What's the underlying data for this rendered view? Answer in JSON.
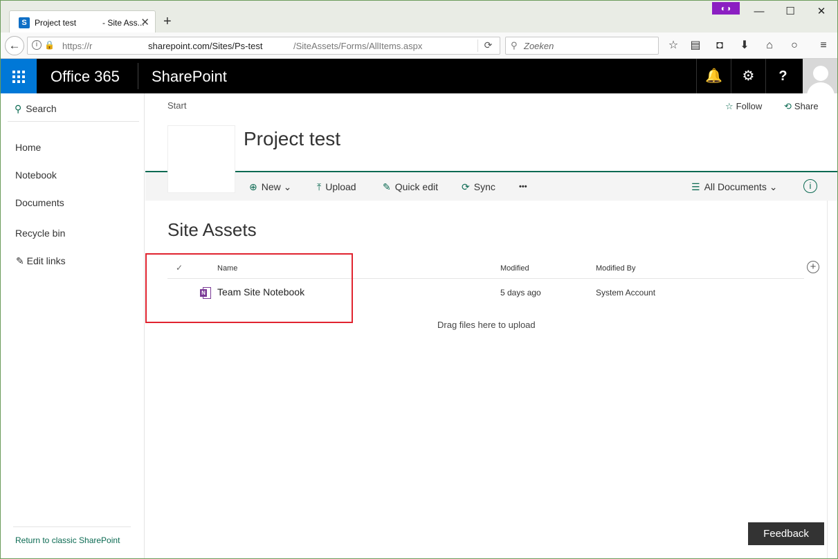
{
  "browser": {
    "tab_title_left": "Project test",
    "tab_title_right": "- Site Ass...",
    "tab_favicon": "S",
    "tab_close": "✕",
    "new_tab": "+",
    "window_min": "—",
    "window_max": "☐",
    "window_close": "✕",
    "url_prefix": "https://r",
    "url_domain": "sharepoint.com/Sites/Ps-test",
    "url_path": "/SiteAssets/Forms/AllItems.aspx",
    "search_placeholder": "Zoeken"
  },
  "suite": {
    "app_launcher_label": "Office 365",
    "product": "SharePoint",
    "notifications_glyph": "🔔",
    "settings_glyph": "⚙",
    "help_glyph": "?"
  },
  "left_nav": {
    "search_label": "Search",
    "items": [
      "Home",
      "Notebook",
      "Documents",
      "Recycle bin"
    ],
    "edit_links": "Edit links",
    "classic_link": "Return to classic SharePoint"
  },
  "site": {
    "breadcrumb": "Start",
    "follow": "Follow",
    "share": "Share",
    "title": "Project test"
  },
  "commands": {
    "new": "New",
    "upload": "Upload",
    "quick_edit": "Quick edit",
    "sync": "Sync",
    "more": "•••",
    "view": "All Documents"
  },
  "library": {
    "title": "Site Assets",
    "columns": {
      "name": "Name",
      "modified": "Modified",
      "modified_by": "Modified By"
    },
    "rows": [
      {
        "name": "Team Site Notebook",
        "modified": "5 days ago",
        "modified_by": "System Account"
      }
    ],
    "drag_hint": "Drag files here to upload"
  },
  "feedback": "Feedback",
  "colors": {
    "accent": "#0b6a52",
    "waffle": "#0078d7",
    "highlight": "#e0232f"
  }
}
